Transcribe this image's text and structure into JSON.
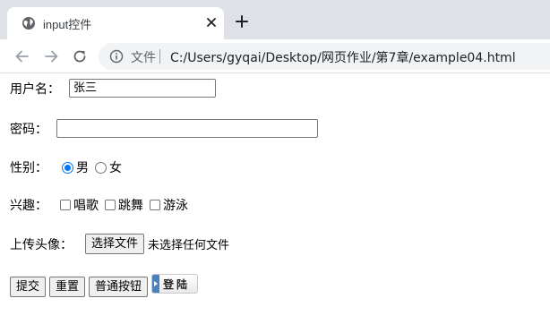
{
  "browser": {
    "tab_title": "input控件",
    "address_label": "文件",
    "url": "C:/Users/gyqai/Desktop/网页作业/第7章/example04.html"
  },
  "form": {
    "username": {
      "label": "用户名：",
      "value": "张三"
    },
    "password": {
      "label": "密码：",
      "value": ""
    },
    "gender": {
      "label": "性别：",
      "options": [
        "男",
        "女"
      ],
      "selected": "男"
    },
    "hobbies": {
      "label": "兴趣：",
      "options": [
        "唱歌",
        "跳舞",
        "游泳"
      ]
    },
    "avatar": {
      "label": "上传头像：",
      "button": "选择文件",
      "status": "未选择任何文件"
    },
    "buttons": {
      "submit": "提交",
      "reset": "重置",
      "normal": "普通按钮",
      "image_button_text": "登陆"
    }
  },
  "colors": {
    "accent": "#0075ff",
    "tabstrip": "#dee1e6",
    "omnibox": "#f1f3f4"
  },
  "icons": [
    "globe-icon",
    "close-icon",
    "plus-icon",
    "back-icon",
    "forward-icon",
    "reload-icon",
    "info-icon"
  ]
}
